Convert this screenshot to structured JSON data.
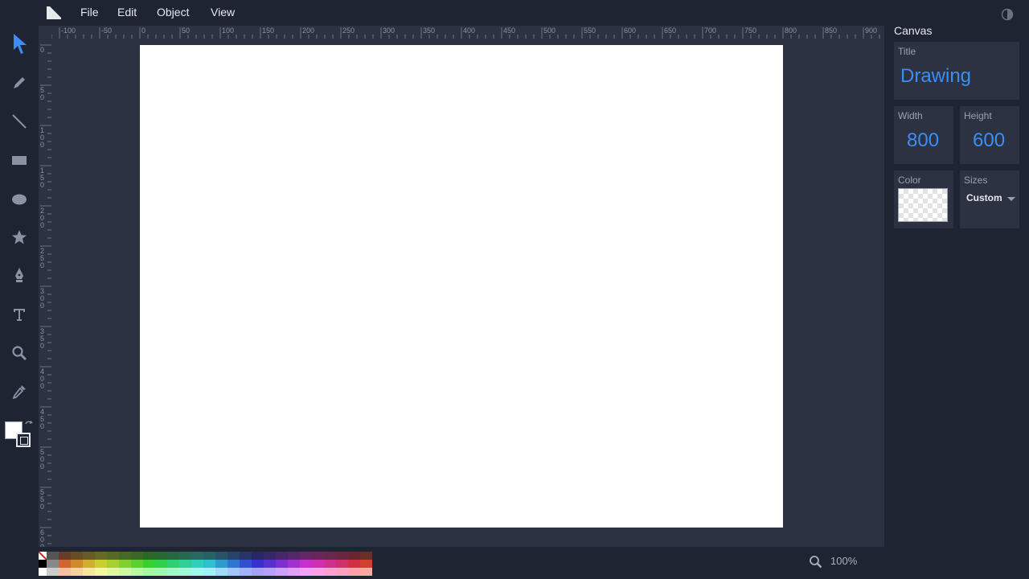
{
  "menubar": {
    "items": [
      "File",
      "Edit",
      "Object",
      "View"
    ]
  },
  "toolbar": {
    "tools": [
      "select-icon",
      "pencil-icon",
      "line-icon",
      "rectangle-icon",
      "ellipse-icon",
      "star-icon",
      "pen-icon",
      "text-icon",
      "zoom-tool-icon",
      "eyedropper-icon"
    ],
    "active_tool": "select-icon",
    "accent": "#3a8ef6"
  },
  "rulers": {
    "horizontal_labels": [
      "-100",
      "-50",
      "0",
      "50",
      "100",
      "150",
      "200",
      "250",
      "300",
      "350",
      "400",
      "450",
      "500",
      "550",
      "600",
      "650",
      "700",
      "750",
      "800",
      "850",
      "900"
    ],
    "vertical_labels": [
      "0",
      "50",
      "100",
      "150",
      "200",
      "250",
      "300",
      "350",
      "400",
      "450",
      "500",
      "550",
      "600"
    ]
  },
  "panel": {
    "section_title": "Canvas",
    "title_label": "Title",
    "title_value": "Drawing",
    "width_label": "Width",
    "width_value": "800",
    "height_label": "Height",
    "height_value": "600",
    "color_label": "Color",
    "sizes_label": "Sizes",
    "sizes_value": "Custom"
  },
  "status": {
    "zoom": "100%"
  },
  "colors": {
    "background": "#1f2433",
    "workarea": "#2c3241",
    "canvas": "#ffffff",
    "value_blue": "#3a8ef6"
  }
}
